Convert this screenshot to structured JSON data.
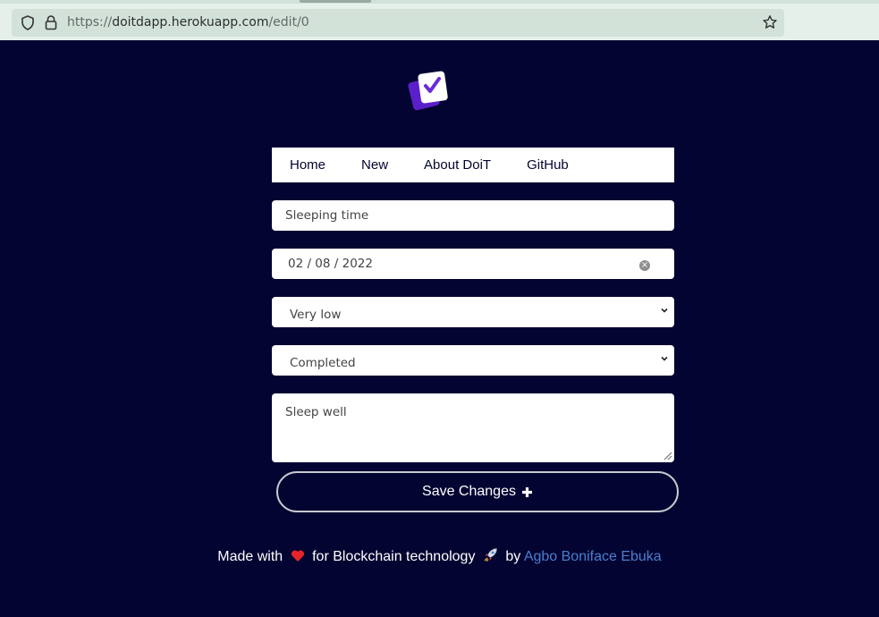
{
  "browser": {
    "url_prefix": "https://",
    "url_host": "doitdapp.herokuapp.com",
    "url_path": "/edit/0"
  },
  "nav": {
    "items": [
      "Home",
      "New",
      "About DoiT",
      "GitHub"
    ]
  },
  "form": {
    "title_value": "Sleeping time",
    "date_value": "02 / 08 / 2022",
    "priority_value": "Very low",
    "status_value": "Completed",
    "description_value": "Sleep well",
    "save_label": "Save Changes"
  },
  "footer": {
    "made_with": "Made with",
    "for_text": "for Blockchain technology",
    "by_text": "by",
    "author": "Agbo Boniface Ebuka"
  },
  "icons": {
    "heart": "heart-icon",
    "rocket": "rocket-icon",
    "plus": "plus-icon"
  },
  "colors": {
    "background": "#030431",
    "accent": "#6a2bd9",
    "link": "#4a7fd0"
  }
}
